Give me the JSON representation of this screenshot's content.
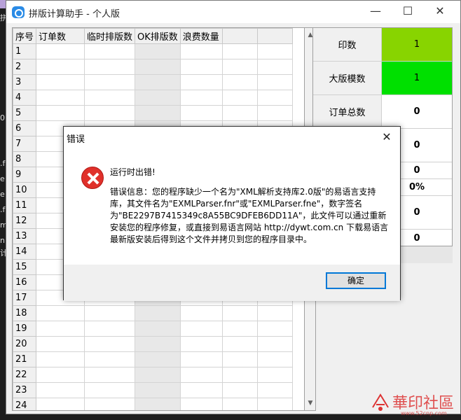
{
  "window": {
    "title": "拼版计算助手 - 个人版",
    "controls": {
      "minimize": "—",
      "maximize": "☐",
      "close": "✕"
    }
  },
  "grid": {
    "headers": [
      "序号",
      "订单数",
      "临时排版数",
      "OK排版数",
      "浪费数量",
      "",
      ""
    ],
    "rows": [
      "1",
      "2",
      "3",
      "4",
      "5",
      "6",
      "7",
      "8",
      "9",
      "10",
      "11",
      "12",
      "13",
      "14",
      "15",
      "16",
      "17",
      "18",
      "19",
      "20",
      "21",
      "22",
      "23",
      "24"
    ]
  },
  "stats": {
    "rows": [
      {
        "label": "印数",
        "value": "1"
      },
      {
        "label": "大版模数",
        "value": "1"
      },
      {
        "label": "订单总数",
        "value": "0"
      },
      {
        "label": "",
        "value": "0"
      },
      {
        "label": "",
        "value": "0"
      },
      {
        "label": "",
        "value": "0%"
      },
      {
        "label": "",
        "value": "0"
      },
      {
        "label": "",
        "value": "0"
      }
    ],
    "colors": {
      "print_count": "#88d400",
      "sheet_count": "#00e000"
    }
  },
  "dialog": {
    "title": "错误",
    "close_glyph": "✕",
    "heading": "运行时出错!",
    "message": "错误信息：您的程序缺少一个名为\"XML解析支持库2.0版\"的易语言支持库，其文件名为\"EXMLParser.fnr\"或\"EXMLParser.fne\"，数字签名为\"BE2297B7415349c8A55BC9DFEB6DD11A\"，此文件可以通过重新安装您的程序修复，或直接到易语言网站 http://dywt.com.cn 下载易语言最新版安装后得到这个文件并拷贝到您的程序目录中。",
    "ok_label": "确定",
    "icon": "error-icon"
  },
  "watermark": {
    "text": "華印社區",
    "url": "www.52cnp.com"
  },
  "background": {
    "glyphs": [
      "拼",
      "0",
      ".f",
      "e",
      "e",
      ".f",
      "m",
      "n.",
      "计"
    ]
  }
}
